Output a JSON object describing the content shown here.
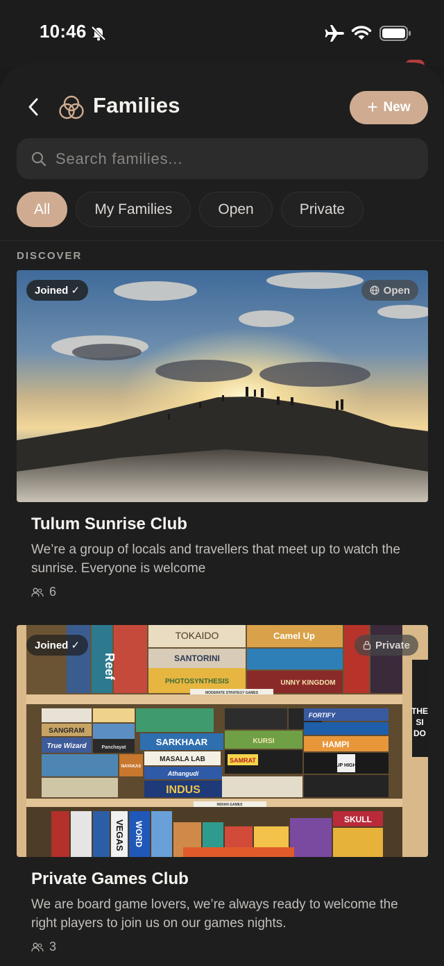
{
  "status_bar": {
    "time": "10:46",
    "icons": [
      "bell-slash-icon",
      "airplane-icon",
      "wifi-icon",
      "battery-icon"
    ]
  },
  "header": {
    "title": "Families",
    "new_button_label": "New",
    "icons": [
      "chevron-left-icon",
      "families-logo-icon",
      "plus-icon"
    ]
  },
  "search": {
    "placeholder": "Search families...",
    "value": ""
  },
  "filters": [
    {
      "label": "All",
      "active": true
    },
    {
      "label": "My Families",
      "active": false
    },
    {
      "label": "Open",
      "active": false
    },
    {
      "label": "Private",
      "active": false
    }
  ],
  "section_label": "DISCOVER",
  "colors": {
    "accent": "#cfac91",
    "background": "#1e1e1e",
    "surface": "#2c2c2c"
  },
  "families": [
    {
      "joined_badge": "Joined ✓",
      "visibility": "Open",
      "visibility_icon": "globe-icon",
      "title": "Tulum Sunrise Club",
      "description": "We’re a group of locals and travellers that meet up to watch the sunrise. Everyone is welcome",
      "members": "6",
      "image": "sunrise-over-hill-photo"
    },
    {
      "joined_badge": "Joined ✓",
      "visibility": "Private",
      "visibility_icon": "lock-icon",
      "title": "Private Games Club",
      "description": "We are board game lovers, we’re always ready to welcome the right players to join us on our games nights.",
      "members": "3",
      "image": "board-game-shelf-photo",
      "game_box_labels": [
        "TOKAIDO",
        "Camel Up",
        "SANTORINI",
        "PHOTOSYNTHESIS",
        "Reef",
        "SANGRAM",
        "True Wizard",
        "SARKHAAR",
        "MASALA LAB",
        "SAMRAT",
        "Athangudi",
        "INDUS",
        "HAMPI",
        "UP HIGH",
        "SKULL",
        "FORTIFY",
        "VEGAS",
        "WORD",
        "KURSI",
        "NAYAKAS",
        "Panchayat",
        "UNNY KINGDOM",
        "MODERATE STRATEGY GAMES",
        "INDIAN GAMES",
        "THE",
        "SI",
        "DO"
      ]
    }
  ]
}
